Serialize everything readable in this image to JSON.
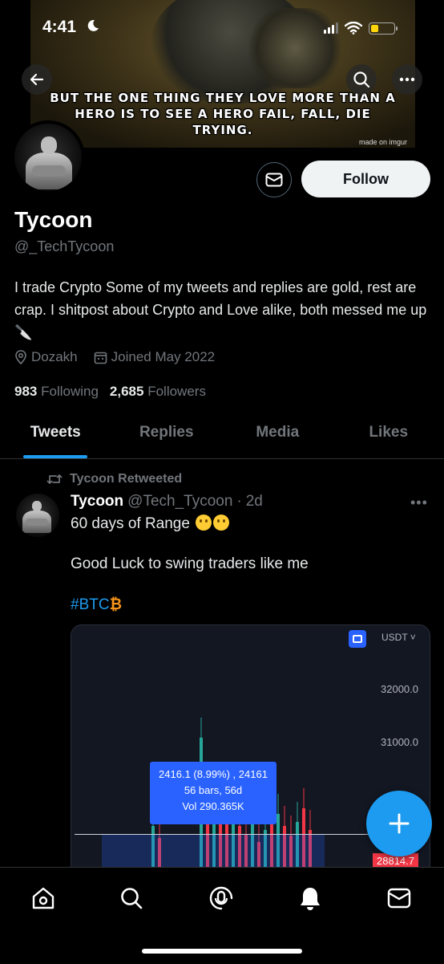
{
  "status_bar": {
    "time": "4:41"
  },
  "banner": {
    "meme_text": "BUT THE ONE THING THEY LOVE MORE THAN A\nHERO IS TO SEE A HERO FAIL, FALL, DIE\nTRYING.",
    "watermark": "made on imgur"
  },
  "profile": {
    "name": "Tycoon",
    "handle": "@_TechTycoon",
    "bio": "I trade Crypto Some of my tweets and replies are gold, rest are crap. I shitpost about Crypto and Love alike, both messed me up 🔪",
    "location": "Dozakh",
    "joined": "Joined May 2022",
    "following_count": "983",
    "following_label": "Following",
    "followers_count": "2,685",
    "followers_label": "Followers",
    "follow_label": "Follow"
  },
  "tabs": [
    {
      "label": "Tweets",
      "active": true
    },
    {
      "label": "Replies",
      "active": false
    },
    {
      "label": "Media",
      "active": false
    },
    {
      "label": "Likes",
      "active": false
    }
  ],
  "tweet": {
    "retweet_label": "Tycoon Retweeted",
    "author_name": "Tycoon",
    "author_handle": "@Tech_Tycoon",
    "separator": "·",
    "time": "2d",
    "line1": "60 days of Range",
    "line2": "Good Luck to swing traders like me",
    "hashtag": "#BTC",
    "hashtag_symbol": "₿"
  },
  "chart_data": {
    "type": "candlestick",
    "currency_label": "USDT",
    "y_ticks": [
      "32000.0",
      "31000.0"
    ],
    "tooltip": {
      "line1": "2416.1 (8.99%) , 24161",
      "line2": "56 bars, 56d",
      "line3": "Vol 290.365K"
    },
    "current_price": "28814.7",
    "colors": {
      "up": "#26a69a",
      "down": "#f23645",
      "tooltip": "#2962ff"
    }
  },
  "colors": {
    "accent": "#1d9bf0",
    "background": "#000000",
    "muted": "#71767b"
  },
  "icons": {
    "back": "arrow-left-icon",
    "search": "search-icon",
    "more": "more-icon",
    "message": "mail-icon",
    "location": "location-pin-icon",
    "calendar": "calendar-icon",
    "retweet": "retweet-icon",
    "compose": "plus-icon",
    "nav": [
      "home-icon",
      "search-icon",
      "spaces-icon",
      "bell-icon",
      "mail-icon"
    ]
  }
}
